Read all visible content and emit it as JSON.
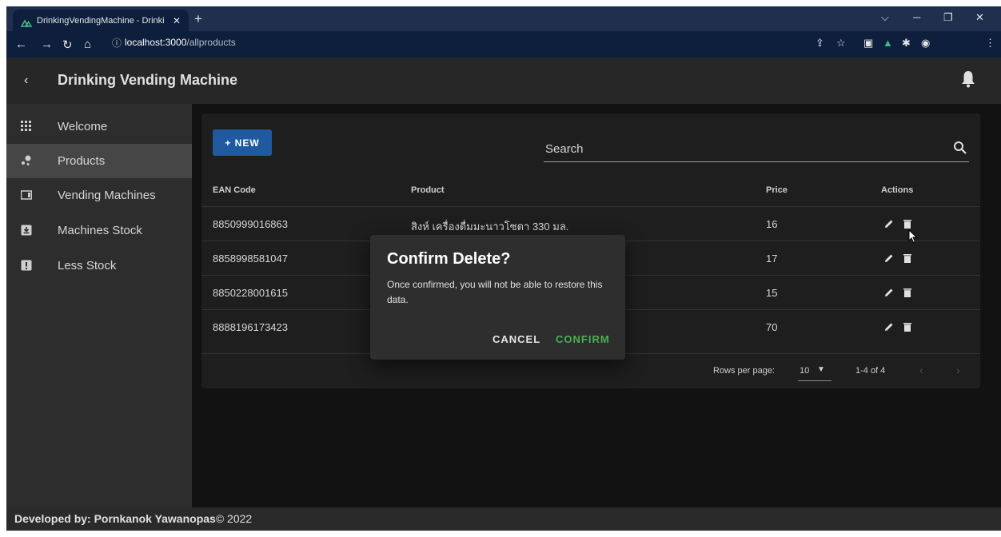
{
  "browser": {
    "tab_title": "DrinkingVendingMachine - Drinki",
    "tab_close": "✕",
    "new_tab": "+",
    "url_host": "localhost:3000",
    "url_path": "/allproducts"
  },
  "app": {
    "title": "Drinking Vending Machine"
  },
  "sidebar": {
    "items": [
      {
        "label": "Welcome",
        "icon": "grid-icon"
      },
      {
        "label": "Products",
        "icon": "bubble-icon",
        "active": true
      },
      {
        "label": "Vending Machines",
        "icon": "machine-icon"
      },
      {
        "label": "Machines Stock",
        "icon": "download-box-icon"
      },
      {
        "label": "Less Stock",
        "icon": "alert-box-icon"
      }
    ]
  },
  "toolbar": {
    "new_label": "+ NEW",
    "search_placeholder": "Search"
  },
  "table": {
    "headers": {
      "ean": "EAN Code",
      "product": "Product",
      "price": "Price",
      "actions": "Actions"
    },
    "rows": [
      {
        "ean": "8850999016863",
        "product": "สิงห์ เครื่องดื่มมะนาวโซดา 330 มล.",
        "price": "16"
      },
      {
        "ean": "8858998581047",
        "product": "",
        "price": "17"
      },
      {
        "ean": "8850228001615",
        "product": "",
        "price": "15"
      },
      {
        "ean": "8888196173423",
        "product": "",
        "price": "70"
      }
    ],
    "rows_per_page_label": "Rows per page:",
    "rows_per_page_value": "10",
    "range": "1-4 of 4"
  },
  "dialog": {
    "title": "Confirm Delete?",
    "message": "Once confirmed, you will not be able to restore this data.",
    "cancel": "CANCEL",
    "confirm": "CONFIRM"
  },
  "footer": {
    "label": "Developed by: Pornkanok Yawanopas",
    "suffix": "© 2022"
  },
  "colors": {
    "accent": "#1f5aa0",
    "confirm": "#4caf50",
    "background": "#121212"
  }
}
